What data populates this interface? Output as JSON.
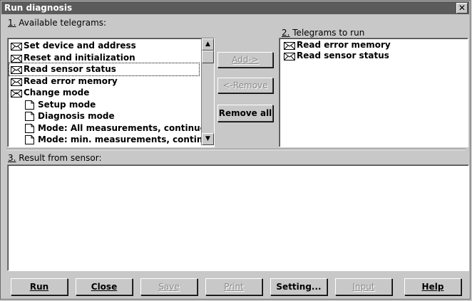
{
  "window": {
    "title": "Run diagnosis",
    "close_glyph": "✕"
  },
  "available": {
    "label_num": "1.",
    "label_text": " Available telegrams:",
    "items": [
      {
        "label": "Set device and address",
        "icon": "envelope-icon"
      },
      {
        "label": "Reset and initialization",
        "icon": "envelope-icon"
      },
      {
        "label": "Read sensor status",
        "icon": "envelope-icon",
        "selected": true
      },
      {
        "label": "Read error memory",
        "icon": "envelope-icon"
      },
      {
        "label": "Change mode",
        "icon": "envelope-open-icon"
      },
      {
        "label": "Setup mode",
        "icon": "document-icon"
      },
      {
        "label": "Diagnosis mode",
        "icon": "document-icon"
      },
      {
        "label": "Mode: All measurements, continuou",
        "icon": "document-icon"
      },
      {
        "label": "Mode: min. measurements, continuo",
        "icon": "document-icon"
      }
    ]
  },
  "to_run": {
    "label_num": "2.",
    "label_text": " Telegrams to run",
    "items": [
      {
        "label": "Read error memory"
      },
      {
        "label": "Read sensor status"
      }
    ]
  },
  "middle_buttons": {
    "add": "Add->",
    "remove": "<-Remove",
    "remove_all": "Remove all"
  },
  "result": {
    "label_num": "3.",
    "label_text": " Result from sensor:"
  },
  "bottom_buttons": {
    "run": "Run",
    "close": "Close",
    "save": "Save",
    "print": "Print",
    "setting": "Setting...",
    "input": "Input",
    "help": "Help"
  },
  "scroll": {
    "up": "▲",
    "down": "▼"
  }
}
